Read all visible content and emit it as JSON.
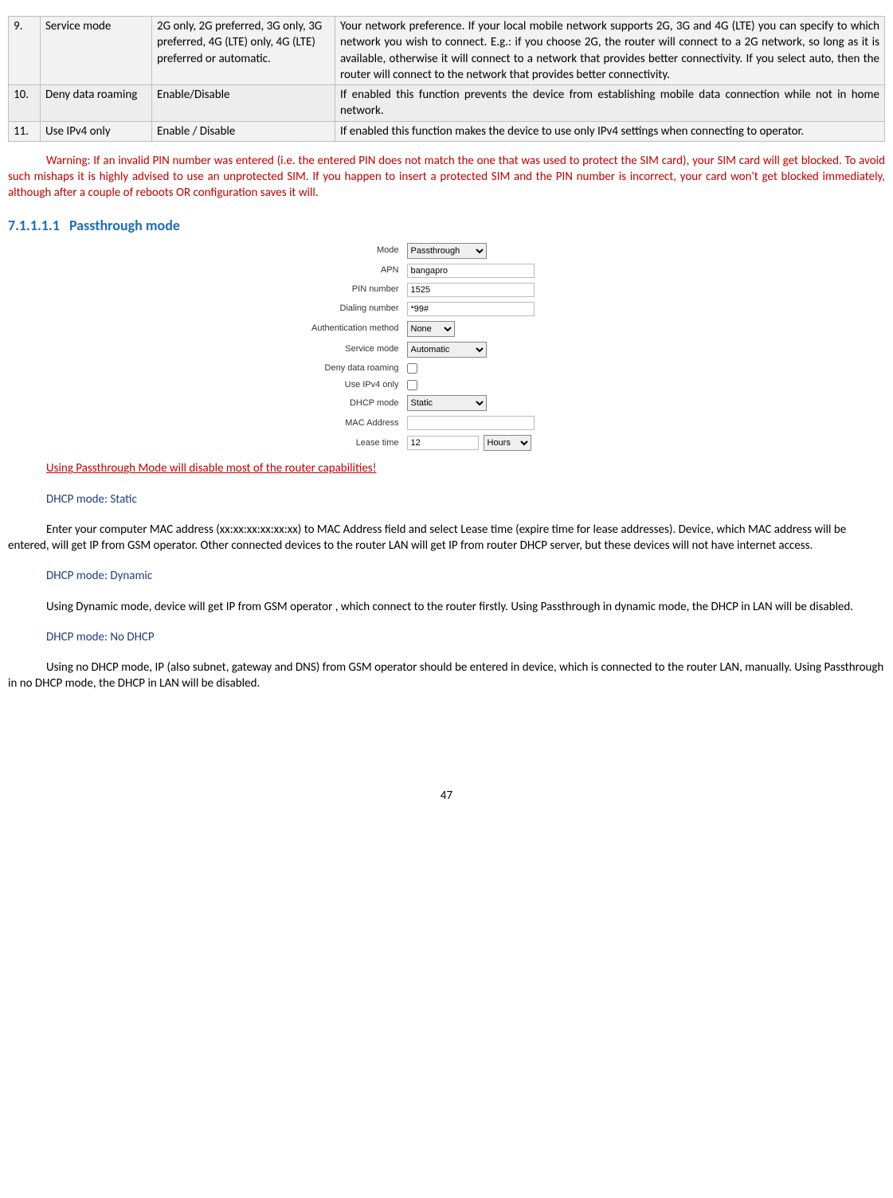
{
  "table": {
    "rows": [
      {
        "num": "9.",
        "name": "Service mode",
        "value": "2G only, 2G preferred, 3G only, 3G preferred, 4G (LTE) only, 4G (LTE) preferred or automatic.",
        "desc": "Your network preference. If your local mobile network supports 2G, 3G and 4G (LTE) you can specify to which network you wish to connect. E.g.: if you choose 2G, the router will connect to a 2G network, so long as it is available, otherwise it will connect to a network that provides better connectivity. If you select auto, then the router will connect to the network that provides better connectivity."
      },
      {
        "num": "10.",
        "name": "Deny data roaming",
        "value": "Enable/Disable",
        "desc": "If enabled this function prevents the device from establishing mobile data connection while not in home network."
      },
      {
        "num": "11.",
        "name": "Use IPv4 only",
        "value": "Enable / Disable",
        "desc": "If enabled this function makes the device to use only IPv4 settings when connecting to operator."
      }
    ]
  },
  "warning": "Warning: If an invalid PIN number was entered (i.e. the entered PIN does not match the one that was used to protect the SIM card), your SIM card will get blocked. To avoid such mishaps it is highly advised to use an unprotected SIM. If you happen to insert a protected SIM and the PIN number is incorrect, your card won't get blocked immediately, although after a couple of reboots OR configuration saves it will.",
  "section": {
    "num": "7.1.1.1.1",
    "title": "Passthrough mode"
  },
  "form": {
    "mode": {
      "label": "Mode",
      "value": "Passthrough"
    },
    "apn": {
      "label": "APN",
      "value": "bangapro"
    },
    "pin": {
      "label": "PIN number",
      "value": "1525"
    },
    "dial": {
      "label": "Dialing number",
      "value": "*99#"
    },
    "auth": {
      "label": "Authentication method",
      "value": "None"
    },
    "svc": {
      "label": "Service mode",
      "value": "Automatic"
    },
    "roam": {
      "label": "Deny data roaming"
    },
    "ipv4": {
      "label": "Use IPv4 only"
    },
    "dhcp": {
      "label": "DHCP mode",
      "value": "Static"
    },
    "mac": {
      "label": "MAC Address",
      "value": ""
    },
    "lease": {
      "label": "Lease time",
      "value": "12",
      "unit": "Hours"
    }
  },
  "notes": {
    "red": "Using Passthrough Mode will disable most of the router capabilities!",
    "static_title": "DHCP mode: Static",
    "static_body": "Enter your computer MAC address (xx:xx:xx:xx:xx:xx) to MAC Address field and select Lease time (expire time for lease addresses). Device, which MAC address will be entered, will get IP from GSM operator. Other connected devices to the router LAN will get IP from router DHCP server, but these devices will not have internet access.",
    "dynamic_title": "DHCP mode: Dynamic",
    "dynamic_body": "Using Dynamic mode, device will get IP from GSM operator , which connect to the router firstly. Using Passthrough in dynamic mode, the DHCP in LAN will be disabled.",
    "nodhcp_title": "DHCP mode: No DHCP",
    "nodhcp_body": "Using no DHCP mode, IP (also subnet, gateway and DNS) from GSM operator should be entered in device, which is connected to the router LAN, manually. Using Passthrough in no DHCP mode, the DHCP in LAN will be disabled."
  },
  "page": "47"
}
